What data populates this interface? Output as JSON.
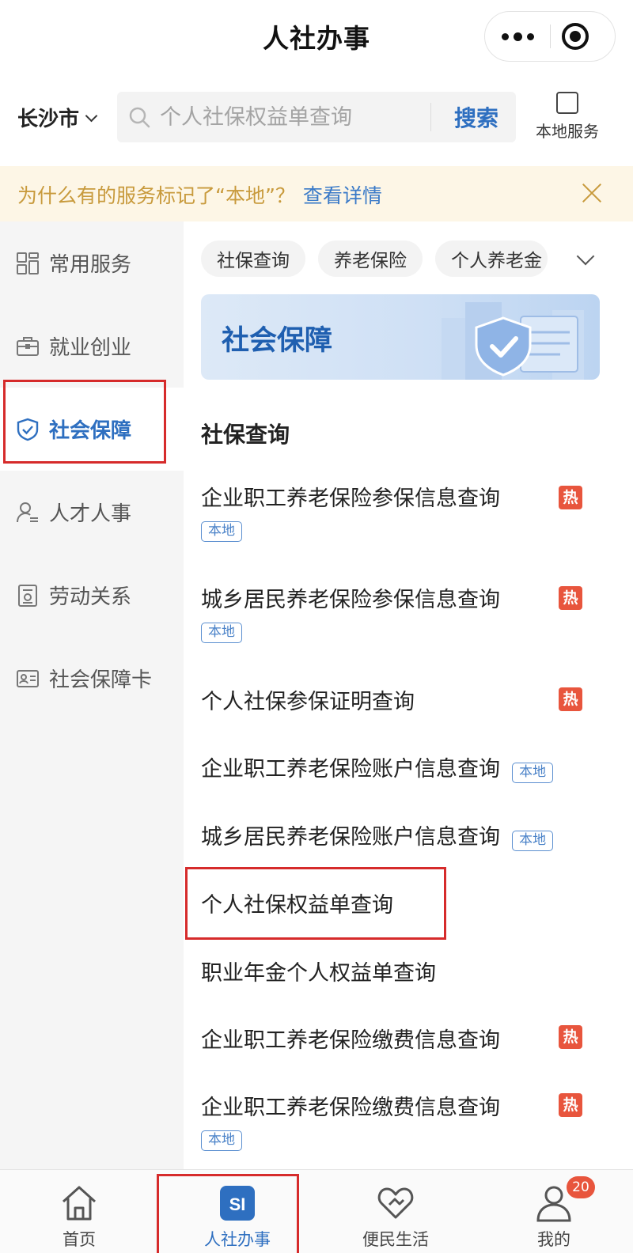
{
  "header": {
    "title": "人社办事"
  },
  "search": {
    "city": "长沙市",
    "placeholder": "个人社保权益单查询",
    "button_label": "搜索",
    "local_service_label": "本地服务"
  },
  "notice": {
    "text": "为什么有的服务标记了“本地”？",
    "link": "查看详情"
  },
  "sidebar": {
    "items": [
      {
        "label": "常用服务",
        "icon": "grid-icon"
      },
      {
        "label": "就业创业",
        "icon": "briefcase-icon"
      },
      {
        "label": "社会保障",
        "icon": "shield-icon",
        "active": true
      },
      {
        "label": "人才人事",
        "icon": "person-list-icon"
      },
      {
        "label": "劳动关系",
        "icon": "document-icon"
      },
      {
        "label": "社会保障卡",
        "icon": "id-card-icon"
      }
    ]
  },
  "chips": [
    "社保查询",
    "养老保险",
    "个人养老金"
  ],
  "banner": {
    "title": "社会保障"
  },
  "section": {
    "title": "社保查询"
  },
  "services": [
    {
      "name": "企业职工养老保险参保信息查询",
      "hot": true,
      "local": true
    },
    {
      "name": "城乡居民养老保险参保信息查询",
      "hot": true,
      "local": true
    },
    {
      "name": "个人社保参保证明查询",
      "hot": true,
      "local": false
    },
    {
      "name": "企业职工养老保险账户信息查询",
      "hot": false,
      "local": true
    },
    {
      "name": "城乡居民养老保险账户信息查询",
      "hot": false,
      "local": true
    },
    {
      "name": "个人社保权益单查询",
      "hot": false,
      "local": false
    },
    {
      "name": "职业年金个人权益单查询",
      "hot": false,
      "local": false
    },
    {
      "name": "企业职工养老保险缴费信息查询",
      "hot": true,
      "local": false
    },
    {
      "name": "企业职工养老保险缴费信息查询",
      "hot": true,
      "local": true
    }
  ],
  "tags": {
    "local": "本地",
    "hot": "热"
  },
  "tabbar": {
    "items": [
      {
        "label": "首页",
        "icon": "home-icon"
      },
      {
        "label": "人社办事",
        "icon": "si-icon",
        "active": true,
        "icon_text": "SI"
      },
      {
        "label": "便民生活",
        "icon": "heart-hands-icon"
      },
      {
        "label": "我的",
        "icon": "user-icon",
        "badge": "20"
      }
    ]
  },
  "colors": {
    "accent": "#2e6fc0",
    "hot": "#e8553d",
    "notice_text": "#c89a3c",
    "highlight": "#d62b2b"
  }
}
